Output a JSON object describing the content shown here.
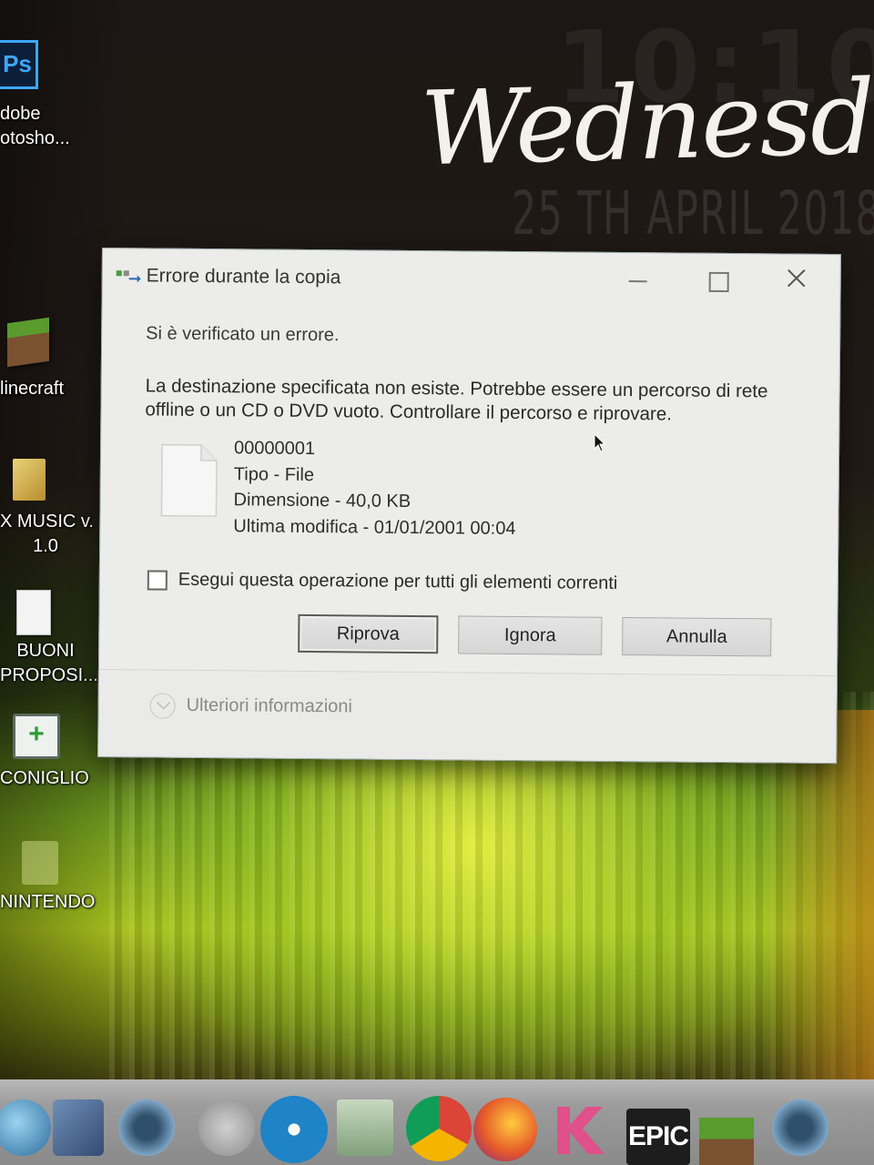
{
  "desktop": {
    "widget": {
      "day": "Wednesda",
      "date": "25 TH APRIL 2018"
    },
    "icons": [
      {
        "name": "photoshop",
        "glyph": "Ps",
        "label_line1": "dobe",
        "label_line2": "otosho..."
      },
      {
        "name": "minecraft",
        "label": "linecraft"
      },
      {
        "name": "music",
        "label_line1": "X MUSIC v.",
        "label_line2": "1.0"
      },
      {
        "name": "buoni",
        "label_line1": "BUONI",
        "label_line2": "PROPOSI..."
      },
      {
        "name": "coniglio",
        "glyph": "+",
        "label": "CONIGLIO"
      },
      {
        "name": "nintendo",
        "label": "NINTENDO"
      }
    ]
  },
  "dialog": {
    "title": "Errore durante la copia",
    "header": "Si è verificato un errore.",
    "message": "La destinazione specificata non esiste. Potrebbe essere un percorso di rete offline o un CD o DVD vuoto. Controllare il percorso e riprovare.",
    "file": {
      "name": "00000001",
      "type": "Tipo - File",
      "size": "Dimensione - 40,0 KB",
      "modified": "Ultima modifica - 01/01/2001 00:04"
    },
    "checkbox_label": "Esegui questa operazione per tutti gli elementi correnti",
    "checkbox_checked": false,
    "buttons": {
      "retry": "Riprova",
      "ignore": "Ignora",
      "cancel": "Annulla"
    },
    "more_info": "Ulteriori informazioni"
  },
  "taskbar": {
    "epic_label": "EPIC"
  }
}
